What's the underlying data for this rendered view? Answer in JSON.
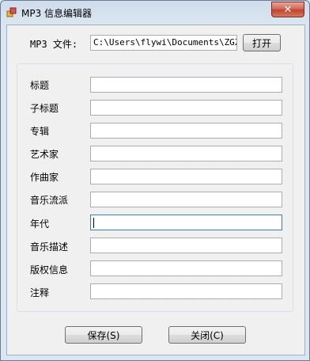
{
  "window": {
    "title": "MP3 信息编辑器",
    "close_glyph": "✕"
  },
  "file": {
    "label": "MP3 文件:",
    "path": "C:\\Users\\flywi\\Documents\\ZGZCD",
    "open_button": "打开"
  },
  "fields": [
    {
      "label": "标题",
      "value": ""
    },
    {
      "label": "子标题",
      "value": ""
    },
    {
      "label": "专辑",
      "value": ""
    },
    {
      "label": "艺术家",
      "value": ""
    },
    {
      "label": "作曲家",
      "value": ""
    },
    {
      "label": "音乐流派",
      "value": ""
    },
    {
      "label": "年代",
      "value": ""
    },
    {
      "label": "音乐描述",
      "value": ""
    },
    {
      "label": "版权信息",
      "value": ""
    },
    {
      "label": "注释",
      "value": ""
    }
  ],
  "buttons": {
    "save": "保存(S)",
    "close": "关闭(C)"
  }
}
